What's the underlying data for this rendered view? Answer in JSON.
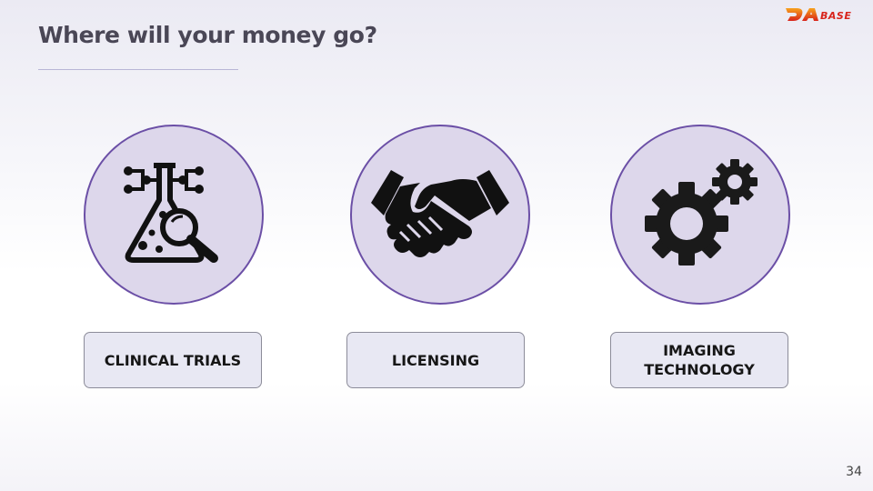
{
  "slide": {
    "title": "Where will your money go?",
    "page_number": "34",
    "logo_text": "DABASE"
  },
  "items": [
    {
      "label": "CLINICAL TRIALS",
      "icon": "lab-flask-magnifier-icon"
    },
    {
      "label": "LICENSING",
      "icon": "handshake-icon"
    },
    {
      "label": "IMAGING\nTECHNOLOGY",
      "icon": "gears-icon"
    }
  ],
  "colors": {
    "circle_fill": "#ddd7eb",
    "circle_border": "#6b4fa6",
    "label_box_fill": "#e8e8f3",
    "title_text": "#4a4756",
    "logo_orange": "#f0821e",
    "logo_red": "#d8241c"
  }
}
